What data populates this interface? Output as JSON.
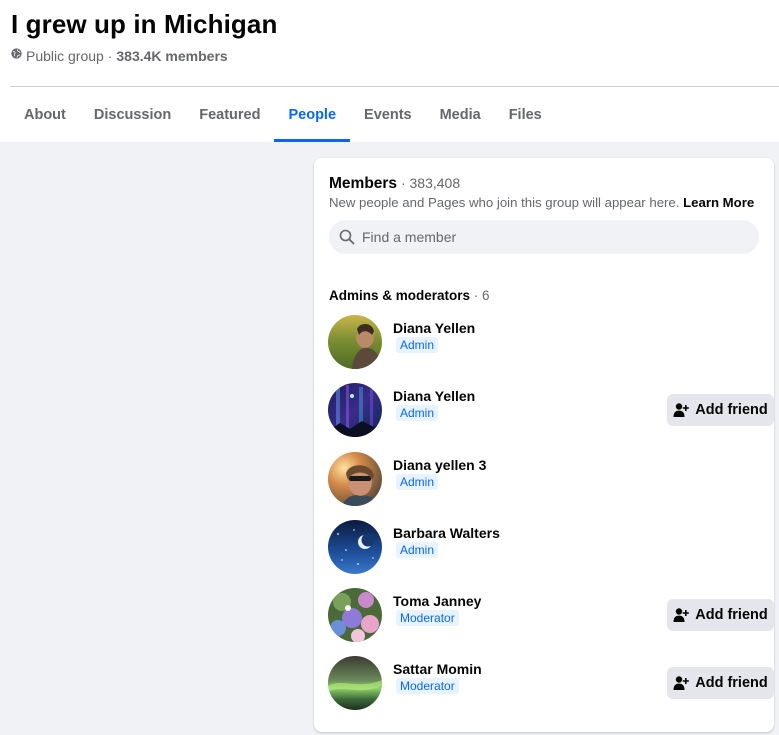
{
  "group": {
    "title": "I grew up in Michigan",
    "privacy": "Public group ·",
    "members_short": "383.4K members"
  },
  "tabs": [
    {
      "label": "About"
    },
    {
      "label": "Discussion"
    },
    {
      "label": "Featured"
    },
    {
      "label": "People",
      "active": true
    },
    {
      "label": "Events"
    },
    {
      "label": "Media"
    },
    {
      "label": "Files"
    }
  ],
  "members": {
    "label": "Members",
    "count": " · 383,408",
    "description": "New people and Pages who join this group will appear here.",
    "learn_more": "Learn More",
    "search_placeholder": "Find a member"
  },
  "admins": {
    "label": "Admins & moderators",
    "count": " · 6",
    "people": [
      {
        "name": "Diana Yellen",
        "role": "Admin",
        "add_friend": ""
      },
      {
        "name": "Diana Yellen",
        "role": "Admin",
        "add_friend": "Add friend"
      },
      {
        "name": "Diana yellen 3",
        "role": "Admin",
        "add_friend": ""
      },
      {
        "name": "Barbara Walters",
        "role": "Admin",
        "add_friend": ""
      },
      {
        "name": "Toma Janney",
        "role": "Moderator",
        "add_friend": "Add friend"
      },
      {
        "name": "Sattar Momin",
        "role": "Moderator",
        "add_friend": "Add friend"
      }
    ]
  },
  "colors": {
    "accent": "#0866ff",
    "page_bg": "#f0f2f5",
    "secondary_text": "#65676b",
    "button_bg": "#e4e6eb"
  }
}
